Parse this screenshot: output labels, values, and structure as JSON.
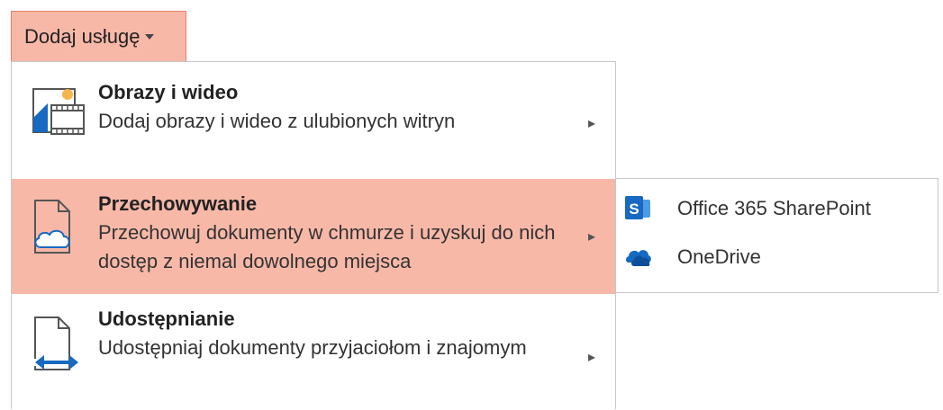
{
  "button": {
    "label": "Dodaj usługę",
    "caret_icon": "caret-down-icon"
  },
  "menu": {
    "items": [
      {
        "title": "Obrazy i wideo",
        "description": "Dodaj obrazy i wideo z ulubionych witryn",
        "icon": "image-video-icon",
        "arrow": "▸"
      },
      {
        "title": "Przechowywanie",
        "description": "Przechowuj dokumenty w chmurze i uzyskuj do nich dostęp z niemal dowolnego miejsca",
        "icon": "cloud-storage-icon",
        "arrow": "▸"
      },
      {
        "title": "Udostępnianie",
        "description": "Udostępniaj dokumenty przyjaciołom i znajomym",
        "icon": "share-icon",
        "arrow": "▸"
      }
    ]
  },
  "submenu": {
    "items": [
      {
        "label": "Office 365 SharePoint",
        "icon": "sharepoint-icon"
      },
      {
        "label": "OneDrive",
        "icon": "onedrive-icon"
      }
    ]
  },
  "colors": {
    "highlight": "#f8b8a8",
    "icon_blue": "#1769c2"
  }
}
